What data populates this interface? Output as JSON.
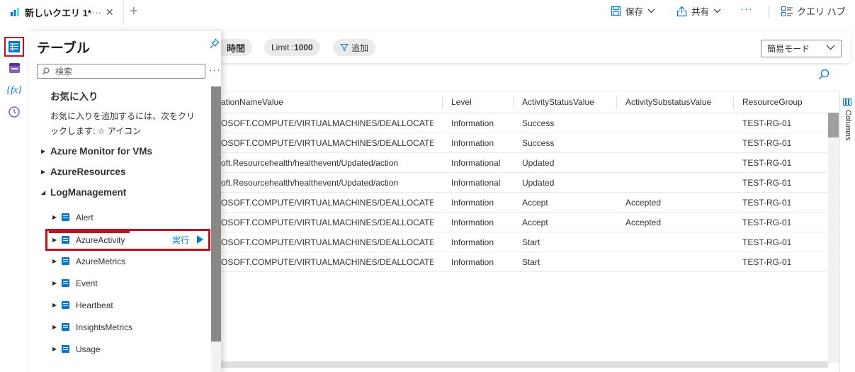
{
  "tab": {
    "title": "新しいクエリ 1*",
    "ellipsis": "···",
    "close": "✕",
    "new_tab": "+"
  },
  "toolbar": {
    "save_label": "保存",
    "share_label": "共有",
    "more_label": "···",
    "query_hub_label": "クエリ ハブ"
  },
  "panel": {
    "title": "テーブル",
    "search_placeholder": "検索",
    "more": "···",
    "favorites_heading": "お気に入り",
    "favorites_hint": "お気に入りを追加するには、次をクリックします: ☆ アイコン",
    "groups": [
      {
        "label": "Azure Monitor for VMs",
        "caret": "▶"
      },
      {
        "label": "AzureResources",
        "caret": "▶"
      },
      {
        "label": "LogManagement",
        "caret": "◢"
      }
    ],
    "tables": [
      {
        "label": "Alert"
      },
      {
        "label": "AzureActivity"
      },
      {
        "label": "AzureMetrics"
      },
      {
        "label": "Event"
      },
      {
        "label": "Heartbeat"
      },
      {
        "label": "InsightsMetrics"
      },
      {
        "label": "Usage"
      }
    ],
    "run_label": "実行"
  },
  "query_bar": {
    "time_label": "時間",
    "limit_prefix": "Limit : ",
    "limit_value": "1000",
    "add_label": "追加",
    "mode_label": "簡易モード"
  },
  "grid": {
    "columns": [
      "ationNameValue",
      "Level",
      "ActivityStatusValue",
      "ActivitySubstatusValue",
      "ResourceGroup"
    ],
    "rows": [
      [
        "OSOFT.COMPUTE/VIRTUALMACHINES/DEALLOCATE/A...",
        "Information",
        "Success",
        "",
        "TEST-RG-01"
      ],
      [
        "OSOFT.COMPUTE/VIRTUALMACHINES/DEALLOCATE/A...",
        "Information",
        "Success",
        "",
        "TEST-RG-01"
      ],
      [
        "oft.Resourcehealth/healthevent/Updated/action",
        "Informational",
        "Updated",
        "",
        "TEST-RG-01"
      ],
      [
        "oft.Resourcehealth/healthevent/Updated/action",
        "Informational",
        "Updated",
        "",
        "TEST-RG-01"
      ],
      [
        "OSOFT.COMPUTE/VIRTUALMACHINES/DEALLOCATE/A...",
        "Information",
        "Accept",
        "Accepted",
        "TEST-RG-01"
      ],
      [
        "OSOFT.COMPUTE/VIRTUALMACHINES/DEALLOCATE/A...",
        "Information",
        "Accept",
        "Accepted",
        "TEST-RG-01"
      ],
      [
        "OSOFT.COMPUTE/VIRTUALMACHINES/DEALLOCATE/A...",
        "Information",
        "Start",
        "",
        "TEST-RG-01"
      ],
      [
        "OSOFT.COMPUTE/VIRTUALMACHINES/DEALLOCATE/A...",
        "Information",
        "Start",
        "",
        "TEST-RG-01"
      ]
    ],
    "columns_sidebar_label": "Columns"
  },
  "colors": {
    "accent": "#0078d4",
    "highlight": "#c50f1f"
  },
  "icons": [
    "log-analytics-icon",
    "save-icon",
    "share-icon",
    "query-hub-icon",
    "tables-icon",
    "queries-icon",
    "functions-icon",
    "history-icon",
    "pin-icon",
    "search-icon",
    "filter-icon",
    "table-icon",
    "run-icon",
    "chevron-down-icon",
    "columns-icon"
  ]
}
